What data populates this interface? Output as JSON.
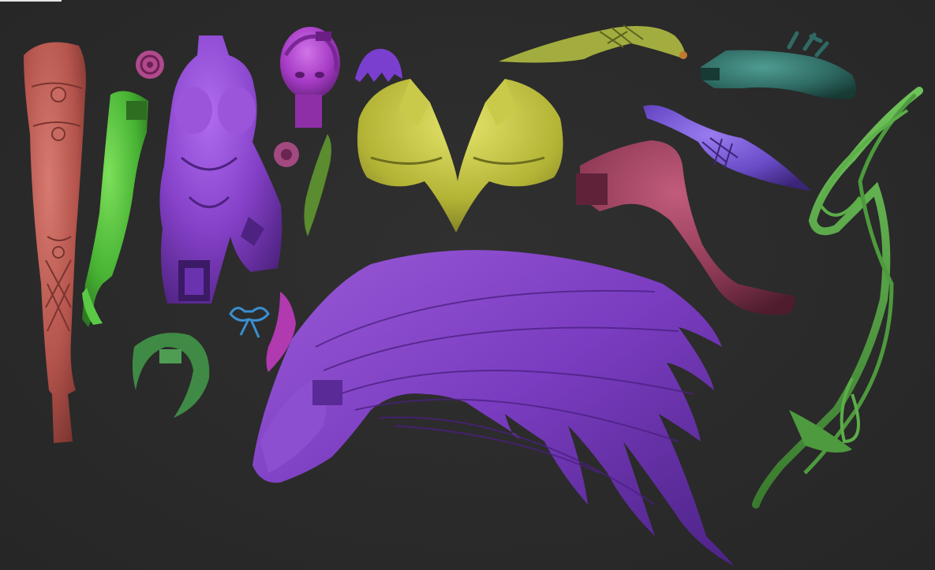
{
  "viewport": {
    "background": "#2b2b2b"
  },
  "parts": [
    {
      "id": "leg-boot-left",
      "color": "#b8574f"
    },
    {
      "id": "arm-green",
      "color": "#4fbf3a"
    },
    {
      "id": "torso-dress",
      "color": "#8a3fc9"
    },
    {
      "id": "head",
      "color": "#a23cbf"
    },
    {
      "id": "hair-bangs",
      "color": "#7b3fd0"
    },
    {
      "id": "crown-tiara",
      "color": "#b6b83a"
    },
    {
      "id": "gauntlet-top",
      "color": "#9da93c"
    },
    {
      "id": "glove-teal",
      "color": "#2f6a63"
    },
    {
      "id": "sleeve-purple",
      "color": "#6a4cc9"
    },
    {
      "id": "leg-bare",
      "color": "#8e3a55"
    },
    {
      "id": "wing",
      "color": "#7d3fc0"
    },
    {
      "id": "vine-green",
      "color": "#4e9a3e"
    },
    {
      "id": "earring-spiral",
      "color": "#b04a8c"
    },
    {
      "id": "ornament-disc",
      "color": "#a24a80"
    },
    {
      "id": "leaf-green",
      "color": "#5b8c2f"
    },
    {
      "id": "bow-blue",
      "color": "#3a8fcf"
    },
    {
      "id": "ribbon-magenta",
      "color": "#b13ab0"
    },
    {
      "id": "wreath-green",
      "color": "#3f8a45"
    }
  ]
}
